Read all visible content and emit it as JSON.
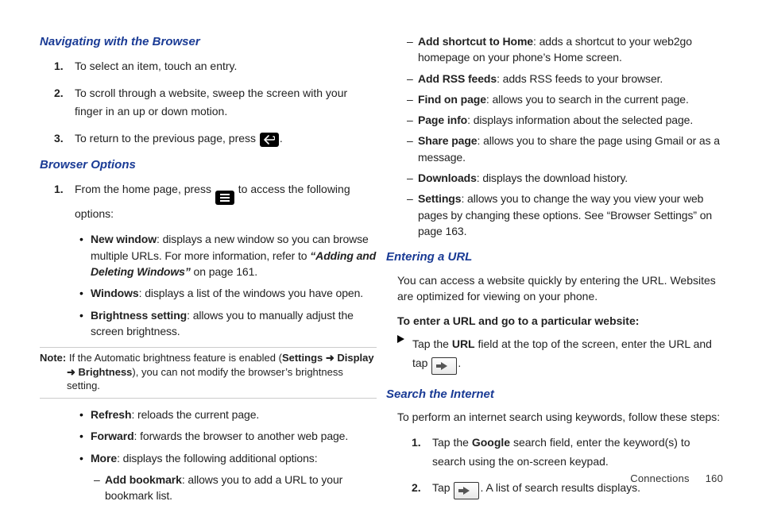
{
  "left": {
    "h1": "Navigating with the Browser",
    "nav1": "To select an item, touch an entry.",
    "nav2": "To scroll through a website, sweep the screen with your finger in an up or down motion.",
    "nav3a": "To return to the previous page, press ",
    "nav3b": ".",
    "h2": "Browser Options",
    "bo1a": "From the home page, press ",
    "bo1b": " to access the following options:",
    "bul1_b": "New window",
    "bul1_t": ": displays a new window so you can browse multiple URLs. For more information, refer to ",
    "bul1_i": "“Adding and Deleting Windows” ",
    "bul1_p": " on page 161.",
    "bul2_b": "Windows",
    "bul2_t": ": displays a list of the windows you have open.",
    "bul3_b": "Brightness setting",
    "bul3_t": ": allows you to manually adjust the screen brightness.",
    "note_label": "Note: ",
    "note_a": "If the Automatic brightness feature is enabled (",
    "note_s": "Settings",
    "note_arrow1": " ➜ ",
    "note_d": "Display",
    "note_arrow2": " ➜ ",
    "note_br": "Brightness",
    "note_b": "), you can not modify the browser’s brightness setting.",
    "bul4_b": "Refresh",
    "bul4_t": ": reloads the current page.",
    "bul5_b": "Forward",
    "bul5_t": ": forwards the browser to another web page.",
    "bul6_b": "More",
    "bul6_t": ": displays the following additional options:",
    "d1_b": "Add bookmark",
    "d1_t": ": allows you to add a URL to your bookmark list."
  },
  "right": {
    "d2_b": "Add shortcut to Home",
    "d2_t": ": adds a shortcut to your web2go homepage on your phone’s Home screen.",
    "d3_b": "Add RSS feeds",
    "d3_t": ": adds RSS feeds to your browser.",
    "d4_b": "Find on page",
    "d4_t": ": allows you to search in the current page.",
    "d5_b": "Page info",
    "d5_t": ": displays information about the selected page.",
    "d6_b": "Share page",
    "d6_t": ": allows you to share the page using Gmail or as a message.",
    "d7_b": "Downloads",
    "d7_t": ": displays the download history.",
    "d8_b": "Settings",
    "d8_t": ": allows you to change the way you view your web pages by changing these options. See “Browser Settings” on page 163.",
    "h3": "Entering a URL",
    "p3": "You can access a website quickly by entering the URL. Websites are optimized for viewing on your phone.",
    "sub": "To enter a URL and go to a particular website:",
    "tri_a": "Tap the ",
    "tri_url": "URL",
    "tri_b": " field at the top of the screen, enter the URL and tap ",
    "tri_c": ".",
    "h4": "Search the Internet",
    "p4": "To perform an internet search using keywords, follow these steps:",
    "s1a": "Tap the ",
    "s1g": "Google",
    "s1b": " search field, enter the keyword(s) to search using the on-screen keypad.",
    "s2a": "Tap ",
    "s2b": ". A list of search results displays."
  },
  "footer": {
    "section": "Connections",
    "page": "160"
  }
}
